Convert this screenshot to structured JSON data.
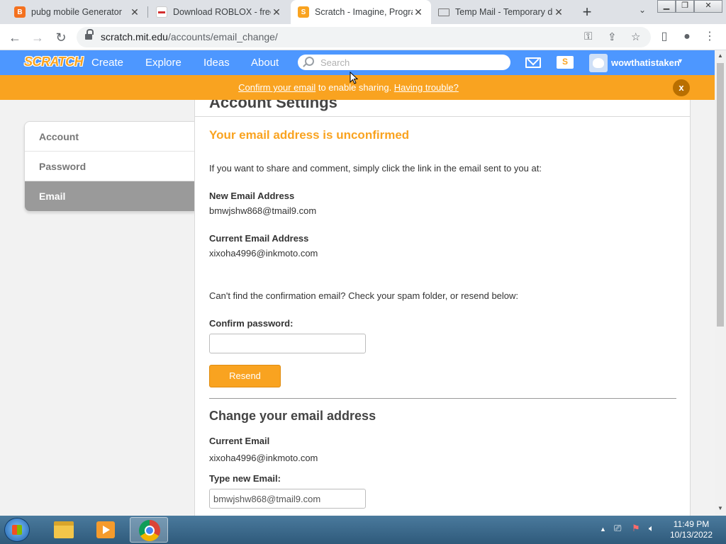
{
  "browser": {
    "tabs": [
      {
        "title": "pubg mobile Generator",
        "favicon_color": "#f4711f"
      },
      {
        "title": "Download ROBLOX - free",
        "favicon_color": "#d32f2f"
      },
      {
        "title": "Scratch - Imagine, Progra",
        "favicon_color": "#f9a320"
      },
      {
        "title": "Temp Mail - Temporary d",
        "favicon_color": "#777777"
      }
    ],
    "url_host": "scratch.mit.edu",
    "url_path": "/accounts/email_change/"
  },
  "scratch_nav": {
    "logo": "SCRATCH",
    "links": [
      "Create",
      "Explore",
      "Ideas",
      "About"
    ],
    "search_placeholder": "Search",
    "username": "wowthatistaken",
    "folder_letter": "S"
  },
  "banner": {
    "link_confirm": "Confirm your email",
    "text_middle": " to enable sharing. ",
    "link_trouble": "Having trouble?",
    "close": "x"
  },
  "sidebar": {
    "items": [
      "Account",
      "Password",
      "Email"
    ]
  },
  "main": {
    "page_title": "Account Settings",
    "warning": "Your email address is unconfirmed",
    "intro": "If you want to share and comment, simply click the link in the email sent to you at:",
    "new_email_label": "New Email Address",
    "new_email_value": "bmwjshw868@tmail9.com",
    "current_email_label": "Current Email Address",
    "current_email_value": "xixoha4996@inkmoto.com",
    "spam_note": "Can't find the confirmation email? Check your spam folder, or resend below:",
    "confirm_password_label": "Confirm password:",
    "confirm_password_value": "",
    "resend_label": "Resend",
    "change_heading": "Change your email address",
    "current_email_label2": "Current Email",
    "current_email_value2": "xixoha4996@inkmoto.com",
    "type_new_label": "Type new Email:",
    "type_new_value": "bmwjshw868@tmail9.com"
  },
  "taskbar": {
    "time": "11:49 PM",
    "date": "10/13/2022"
  },
  "colors": {
    "scratch_blue": "#4d97ff",
    "scratch_orange": "#f9a320"
  }
}
